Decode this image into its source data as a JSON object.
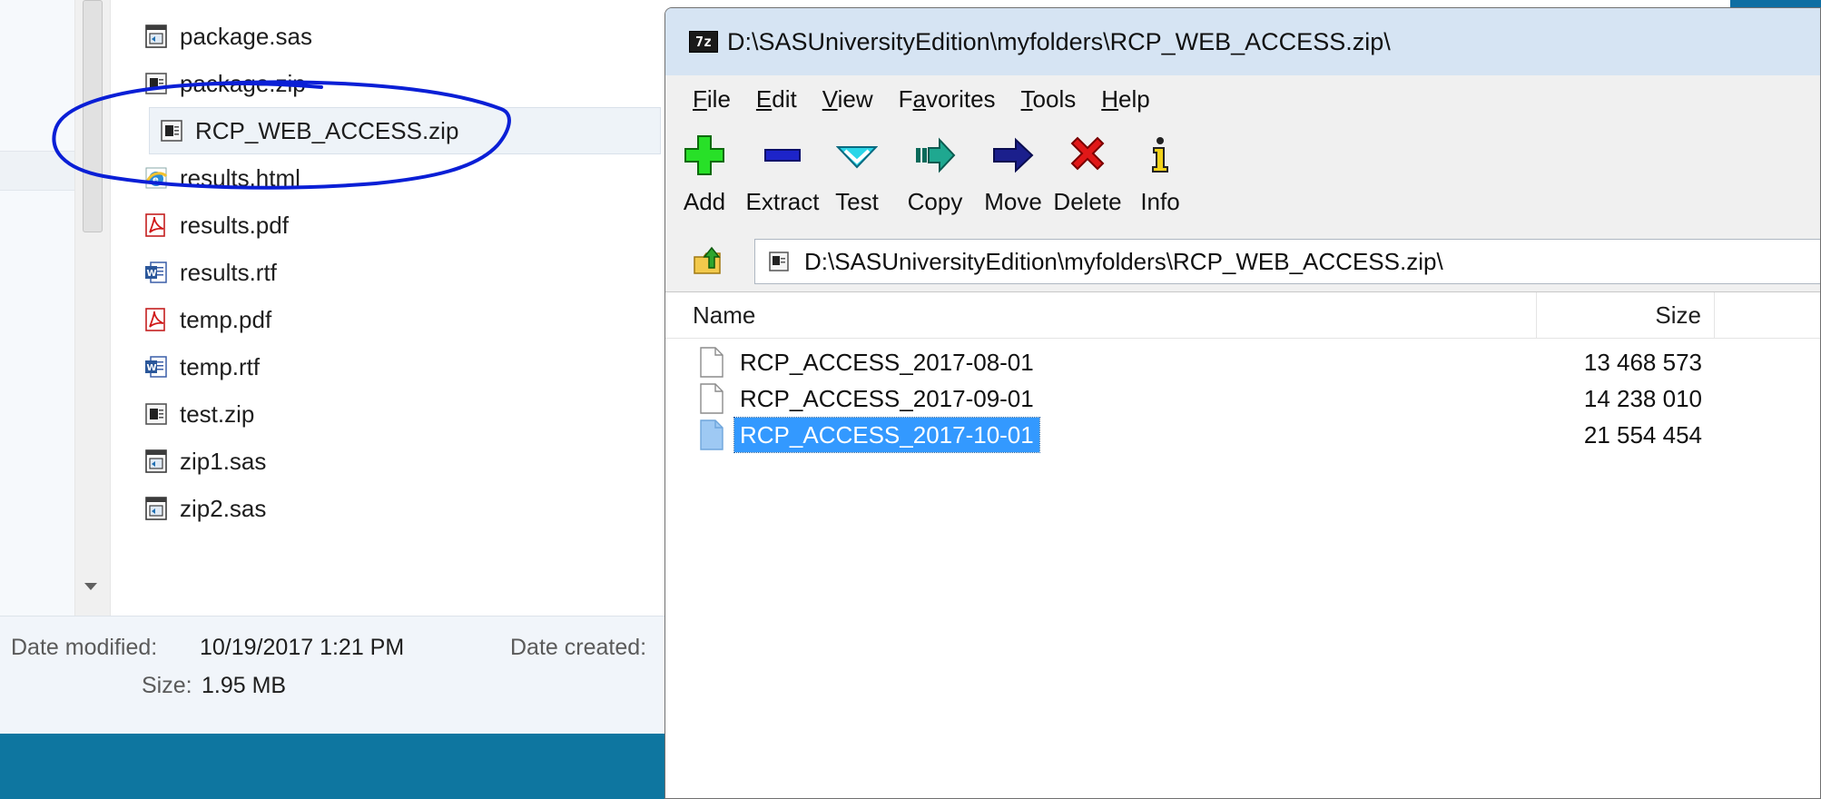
{
  "explorer": {
    "files": [
      {
        "name": "package.sas",
        "icon": "sas-file-icon"
      },
      {
        "name": "package.zip",
        "icon": "zip-file-icon"
      },
      {
        "name": "RCP_WEB_ACCESS.zip",
        "icon": "zip-file-icon",
        "highlighted": true
      },
      {
        "name": "results.html",
        "icon": "html-file-icon"
      },
      {
        "name": "results.pdf",
        "icon": "pdf-file-icon"
      },
      {
        "name": "results.rtf",
        "icon": "word-file-icon"
      },
      {
        "name": "temp.pdf",
        "icon": "pdf-file-icon"
      },
      {
        "name": "temp.rtf",
        "icon": "word-file-icon"
      },
      {
        "name": "test.zip",
        "icon": "zip-file-icon"
      },
      {
        "name": "zip1.sas",
        "icon": "sas-file-icon"
      },
      {
        "name": "zip2.sas",
        "icon": "sas-file-icon"
      }
    ],
    "details": {
      "modified_label": "Date modified:",
      "modified_value": "10/19/2017 1:21 PM",
      "created_label": "Date created:",
      "size_label": "Size:",
      "size_value": "1.95 MB"
    },
    "annotation_color": "#0a1fd6"
  },
  "zipwin": {
    "title": "D:\\SASUniversityEdition\\myfolders\\RCP_WEB_ACCESS.zip\\",
    "app_icon_text": "7z",
    "menu": [
      {
        "label": "File",
        "hotkey_index": 0
      },
      {
        "label": "Edit",
        "hotkey_index": 0
      },
      {
        "label": "View",
        "hotkey_index": 0
      },
      {
        "label": "Favorites",
        "hotkey_index": 1
      },
      {
        "label": "Tools",
        "hotkey_index": 0
      },
      {
        "label": "Help",
        "hotkey_index": 0
      }
    ],
    "toolbar": {
      "add": "Add",
      "extract": "Extract",
      "test": "Test",
      "copy": "Copy",
      "move": "Move",
      "delete": "Delete",
      "info": "Info"
    },
    "address": "D:\\SASUniversityEdition\\myfolders\\RCP_WEB_ACCESS.zip\\",
    "columns": {
      "name": "Name",
      "size": "Size"
    },
    "rows": [
      {
        "name": "RCP_ACCESS_2017-08-01",
        "size": "13 468 573",
        "selected": false
      },
      {
        "name": "RCP_ACCESS_2017-09-01",
        "size": "14 238 010",
        "selected": false
      },
      {
        "name": "RCP_ACCESS_2017-10-01",
        "size": "21 554 454",
        "selected": true
      }
    ],
    "colors": {
      "selection": "#3399ff",
      "title_bg": "#d6e4f3"
    }
  }
}
